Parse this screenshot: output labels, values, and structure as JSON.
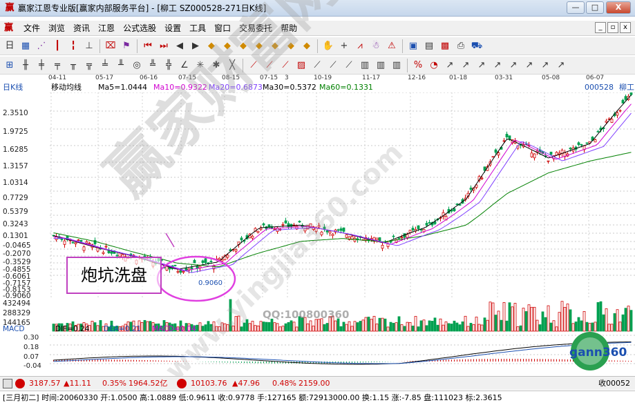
{
  "window": {
    "title": "赢家江恩专业版[赢家内部服务平台] - [柳工  SZ000528-271日K线]",
    "minimize": "—",
    "maximize": "□",
    "close": "X"
  },
  "menu": {
    "items": [
      "文件",
      "浏览",
      "资讯",
      "江恩",
      "公式选股",
      "设置",
      "工具",
      "窗口",
      "交易委托",
      "帮助"
    ],
    "mdi": [
      "_",
      "▫",
      "x"
    ]
  },
  "chart": {
    "dates": [
      "04-11",
      "05-17",
      "06-16",
      "07-15",
      "08-15",
      "07-15",
      "3",
      "10-19",
      "11-17",
      "12-16",
      "01-18",
      "03-31",
      "05-08",
      "06-07"
    ],
    "period_label": "日K线",
    "indicator_name": "移动均线",
    "ma5": "Ma5=1.0444",
    "ma10": "Ma10=0.9322",
    "ma20": "Ma20=0.6873",
    "ma30": "Ma30=0.5372",
    "ma60": "Ma60=0.1331",
    "stock_code": "000528",
    "stock_name": "柳工",
    "price_ticks": [
      "2.3510",
      "1.9725",
      "1.6285",
      "1.3157",
      "1.0314",
      "0.7729",
      "0.5379",
      "0.3243",
      "0.1301",
      "-0.0465",
      "-0.2070",
      "-0.3529",
      "-0.4855",
      "-0.6061",
      "-0.7157",
      "-0.8153",
      "-0.9060"
    ],
    "volume_ticks": [
      "432494",
      "288329",
      "144165"
    ],
    "low_label": "0.9060",
    "annotation": "炮坑洗盘",
    "watermark": "赢家财富网",
    "watermark_url": "www.yingjia360.com",
    "qq": "QQ:100800360",
    "colors": {
      "up": "#d00000",
      "down": "#00a050",
      "ma5": "#000000",
      "ma10": "#d000d0",
      "ma20": "#8040ff",
      "ma60": "#008000",
      "annotation": "#c040c0"
    }
  },
  "chart_data": {
    "type": "line",
    "title": "",
    "series": [
      {
        "name": "Ma5",
        "values": [
          -0.25,
          -0.45,
          -0.62,
          -0.82,
          -0.7,
          -0.1,
          -0.05,
          -0.2,
          -0.38,
          -0.1,
          0.4,
          1.45,
          1.1,
          1.35,
          2.3
        ]
      },
      {
        "name": "Ma60",
        "values": [
          -0.2,
          -0.35,
          -0.55,
          -0.72,
          -0.78,
          -0.55,
          -0.35,
          -0.3,
          -0.36,
          -0.25,
          -0.05,
          0.5,
          0.85,
          1.05,
          1.2
        ]
      }
    ],
    "ylim": [
      -0.906,
      2.351
    ]
  },
  "macd": {
    "title": "MACD",
    "dif": "DIF=0.24",
    "dea": "DEA=0.21",
    "macd": "MACD=0.04",
    "ticks": [
      "0.30",
      "0.18",
      "0.07",
      "-0.04"
    ]
  },
  "status": {
    "idx1_value": "3187.57",
    "idx1_change": "▲11.11",
    "idx1_pct": "0.35%",
    "idx1_amount": "1964.52亿",
    "idx2_value": "10103.76",
    "idx2_change": "▲47.96",
    "idx2_pct": "0.48%",
    "idx2_amount": "2159.00",
    "right_text": "收00052"
  },
  "info": {
    "text": "[三月初二] 时间:20060330 开:1.0500 高:1.0889 低:0.9611 收:0.9778 手:127165 额:72913000.00 换:1.15 涨:-7.85 盘:111023 标:2.3615"
  },
  "gann_logo": "gann360"
}
